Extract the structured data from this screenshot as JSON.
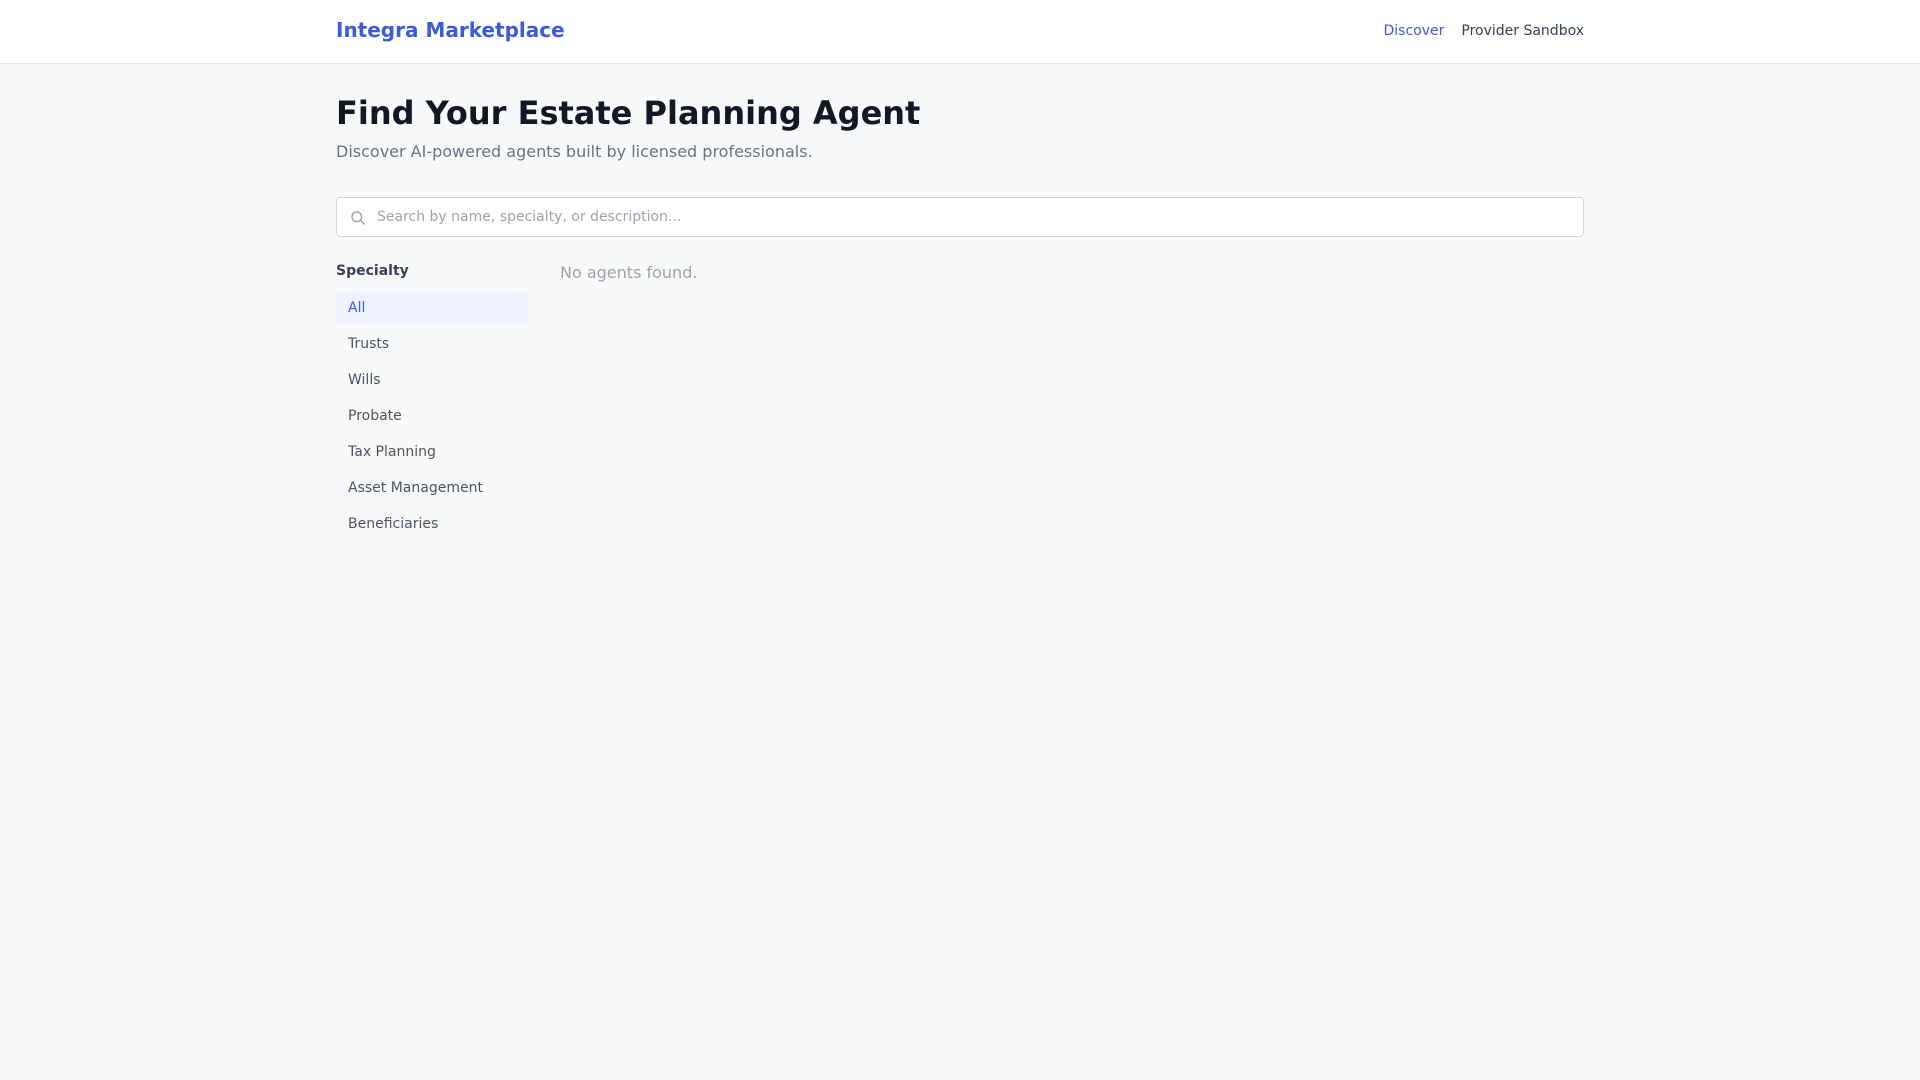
{
  "header": {
    "brand": "Integra Marketplace",
    "nav": [
      {
        "label": "Discover",
        "active": true
      },
      {
        "label": "Provider Sandbox",
        "active": false
      }
    ]
  },
  "page": {
    "title": "Find Your Estate Planning Agent",
    "subtitle": "Discover AI-powered agents built by licensed professionals."
  },
  "search": {
    "icon": "search-icon",
    "placeholder": "Search by name, specialty, or description...",
    "value": ""
  },
  "sidebar": {
    "heading": "Specialty",
    "selected": "All",
    "items": [
      {
        "label": "All"
      },
      {
        "label": "Trusts"
      },
      {
        "label": "Wills"
      },
      {
        "label": "Probate"
      },
      {
        "label": "Tax Planning"
      },
      {
        "label": "Asset Management"
      },
      {
        "label": "Beneficiaries"
      }
    ]
  },
  "results": {
    "empty_message": "No agents found."
  },
  "colors": {
    "accent": "#3b5bdb",
    "selected_bg": "#eef2ff",
    "page_bg": "#f8f9fb"
  }
}
